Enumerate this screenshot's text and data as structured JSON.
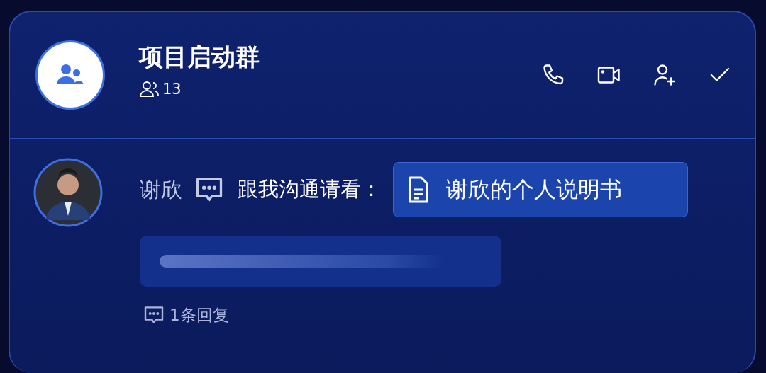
{
  "group": {
    "name": "项目启动群",
    "member_count": "13"
  },
  "header_actions": [
    {
      "kind": "call"
    },
    {
      "kind": "video"
    },
    {
      "kind": "add_member"
    },
    {
      "kind": "done"
    }
  ],
  "message": {
    "sender": "谢欣",
    "text": "跟我沟通请看：",
    "attachment": {
      "title": "谢欣的个人说明书"
    },
    "replies": "1条回复"
  }
}
